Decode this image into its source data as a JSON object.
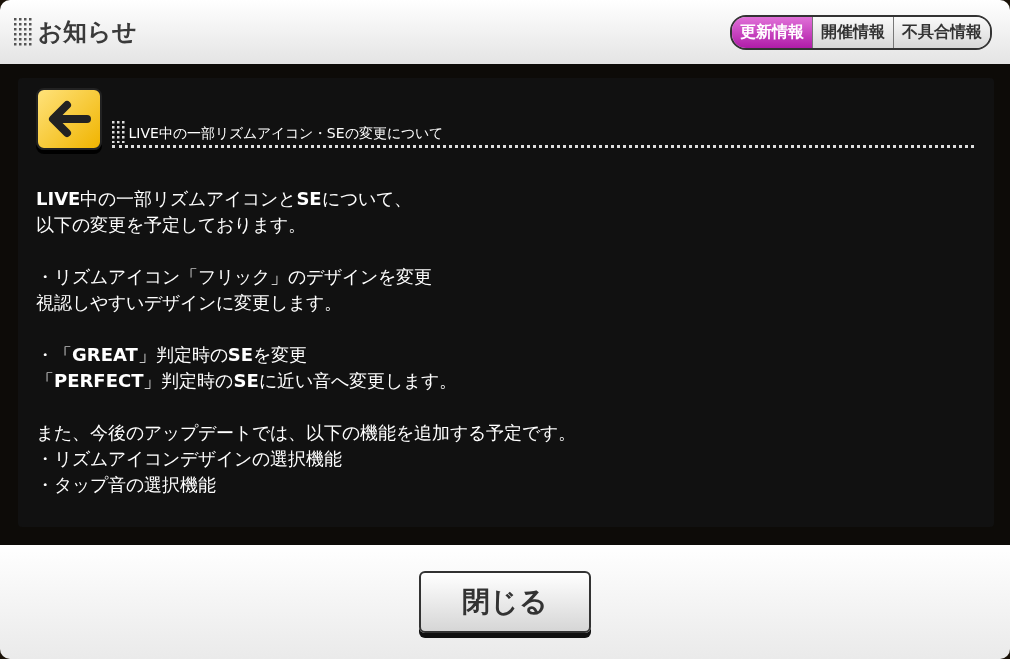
{
  "header": {
    "title": "お知らせ"
  },
  "tabs": [
    {
      "label": "更新情報",
      "selected": true
    },
    {
      "label": "開催情報",
      "selected": false
    },
    {
      "label": "不具合情報",
      "selected": false
    }
  ],
  "article": {
    "title": "LIVE中の一部リズムアイコン・SEの変更について",
    "paragraphs": [
      [
        "**LIVE**中の一部リズムアイコンと**SE**について、",
        "以下の変更を予定しております。"
      ],
      [
        "・リズムアイコン「フリック」のデザインを変更",
        "視認しやすいデザインに変更します。"
      ],
      [
        "・「**GREAT**」判定時の**SE**を変更",
        "「**PERFECT**」判定時の**SE**に近い音へ変更します。"
      ],
      [
        "また、今後のアップデートでは、以下の機能を追加する予定です。",
        "・リズムアイコンデザインの選択機能",
        "・タップ音の選択機能"
      ]
    ]
  },
  "close_button": {
    "label": "閉じる"
  }
}
